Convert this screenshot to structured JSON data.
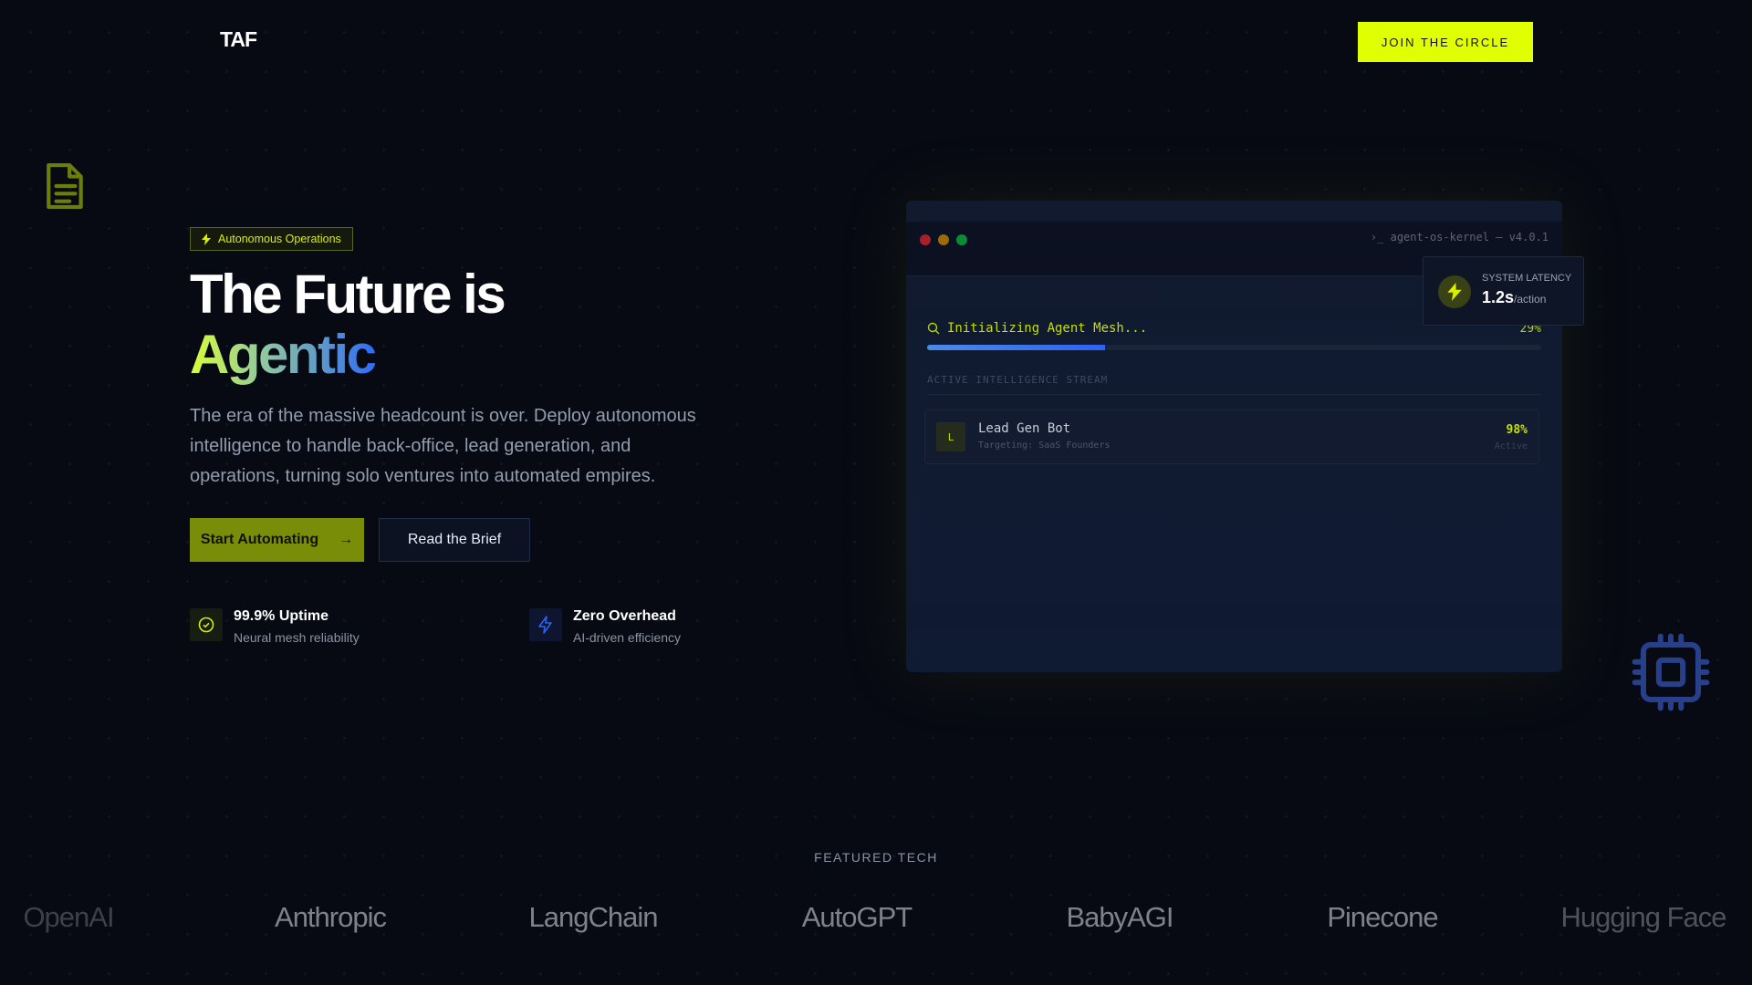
{
  "nav": {
    "logo": "TAF",
    "cta": "JOIN THE CIRCLE"
  },
  "hero": {
    "badge": "Autonomous Operations",
    "title_line1": "The Future is",
    "title_line2": "Agentic",
    "lead": "The era of the massive headcount is over. Deploy autonomous intelligence to handle back-office, lead generation, and operations, turning solo ventures into automated empires.",
    "primary_button": "Start Automating",
    "secondary_button": "Read the Brief",
    "stats": [
      {
        "title": "99.9% Uptime",
        "subtitle": "Neural mesh reliability"
      },
      {
        "title": "Zero Overhead",
        "subtitle": "AI-driven efficiency"
      }
    ]
  },
  "terminal": {
    "title": "agent-os-kernel — v4.0.1",
    "status": "Initializing Agent Mesh...",
    "progress_percent": 29,
    "progress_label": "29%",
    "stream_label": "ACTIVE INTELLIGENCE STREAM",
    "agents": [
      {
        "initial": "L",
        "name": "Lead Gen Bot",
        "target": "Targeting: SaaS Founders",
        "score": "98%",
        "state": "Active"
      }
    ]
  },
  "latency": {
    "label": "SYSTEM LATENCY",
    "value": "1.2s",
    "unit": "/action"
  },
  "featured": {
    "label": "FEATURED TECH",
    "logos": [
      "OpenAI",
      "Anthropic",
      "LangChain",
      "AutoGPT",
      "BabyAGI",
      "Pinecone",
      "Hugging Face"
    ]
  },
  "colors": {
    "accent": "#e0ff00",
    "olive": "#7a8d08",
    "blue": "#2c63f2"
  }
}
